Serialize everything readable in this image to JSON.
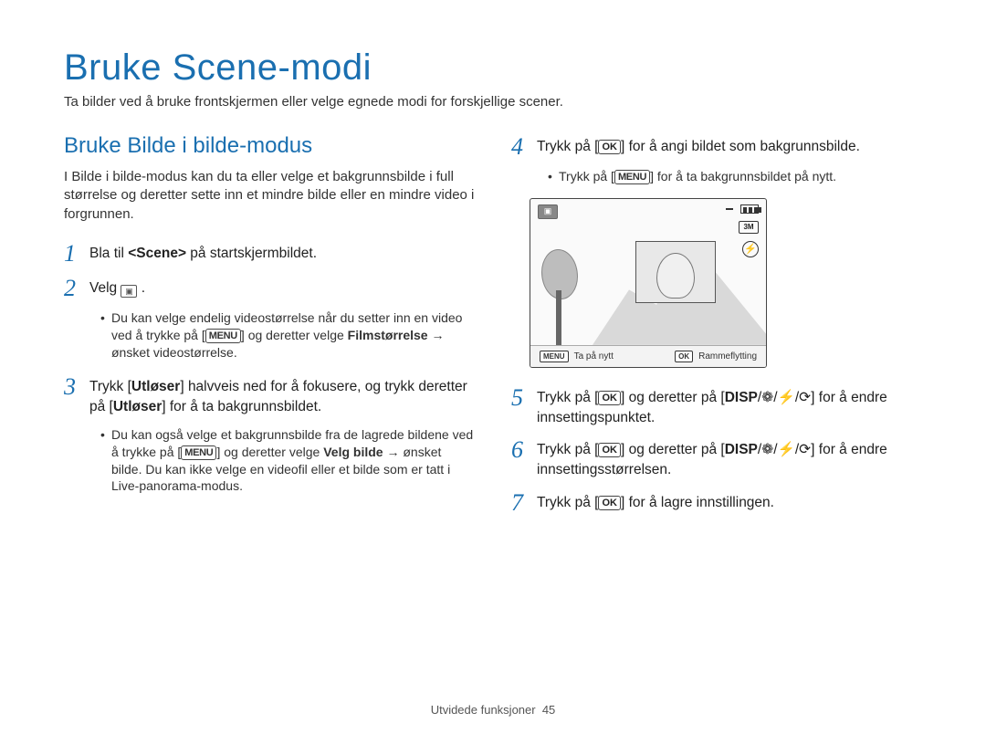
{
  "page": {
    "title": "Bruke Scene-modi",
    "subtitle": "Ta bilder ved å bruke frontskjermen eller velge egnede modi for forskjellige scener."
  },
  "left": {
    "section_title": "Bruke Bilde i bilde-modus",
    "intro": "I Bilde i bilde-modus kan du ta eller velge et bakgrunnsbilde i full størrelse og deretter sette inn et mindre bilde eller en mindre video i forgrunnen.",
    "step1_num": "1",
    "step1_pre": "Bla til ",
    "step1_bold": "<Scene>",
    "step1_post": " på startskjermbildet.",
    "step2_num": "2",
    "step2_text": "Velg ",
    "step2_bullet_a": "Du kan velge endelig videostørrelse når du setter inn en video ved å trykke på [",
    "step2_bullet_b": "] og deretter velge ",
    "step2_bullet_bold": "Filmstørrelse",
    "step2_bullet_c": " → ønsket videostørrelse.",
    "step3_num": "3",
    "step3_a": "Trykk [",
    "step3_b1": "Utløser",
    "step3_c": "] halvveis ned for å fokusere, og trykk deretter på [",
    "step3_b2": "Utløser",
    "step3_d": "] for å ta bakgrunnsbildet.",
    "step3_bullet_a": "Du kan også velge et bakgrunnsbilde fra de lagrede bildene ved å trykke på [",
    "step3_bullet_b": "] og deretter velge ",
    "step3_bullet_bold": "Velg bilde",
    "step3_bullet_c": " → ønsket bilde. Du kan ikke velge en videofil eller et bilde som er tatt i Live-panorama-modus."
  },
  "right": {
    "step4_num": "4",
    "step4_a": "Trykk på [",
    "step4_b": "] for å angi bildet som bakgrunnsbilde.",
    "step4_bullet_a": "Trykk på [",
    "step4_bullet_b": "] for å ta bakgrunnsbildet på nytt.",
    "screen": {
      "size_label": "3M",
      "bottom_left_key": "MENU",
      "bottom_left_text": "Ta på nytt",
      "bottom_right_key": "OK",
      "bottom_right_text": "Rammeflytting"
    },
    "step5_num": "5",
    "step5_a": "Trykk på [",
    "step5_b": "] og deretter på [",
    "step5_c": "] for å endre innsettingspunktet.",
    "step6_num": "6",
    "step6_a": "Trykk på [",
    "step6_b": "] og deretter på [",
    "step6_c": "] for å endre innsettingsstørrelsen.",
    "step7_num": "7",
    "step7_a": "Trykk på [",
    "step7_b": "] for å lagre innstillingen."
  },
  "keys": {
    "ok": "OK",
    "menu": "MENU",
    "disp": "DISP"
  },
  "symbols": {
    "macro": "❁",
    "flash": "⚡",
    "timer": "⟳",
    "slash": "/"
  },
  "footer": {
    "section": "Utvidede funksjoner",
    "page_num": "45"
  }
}
